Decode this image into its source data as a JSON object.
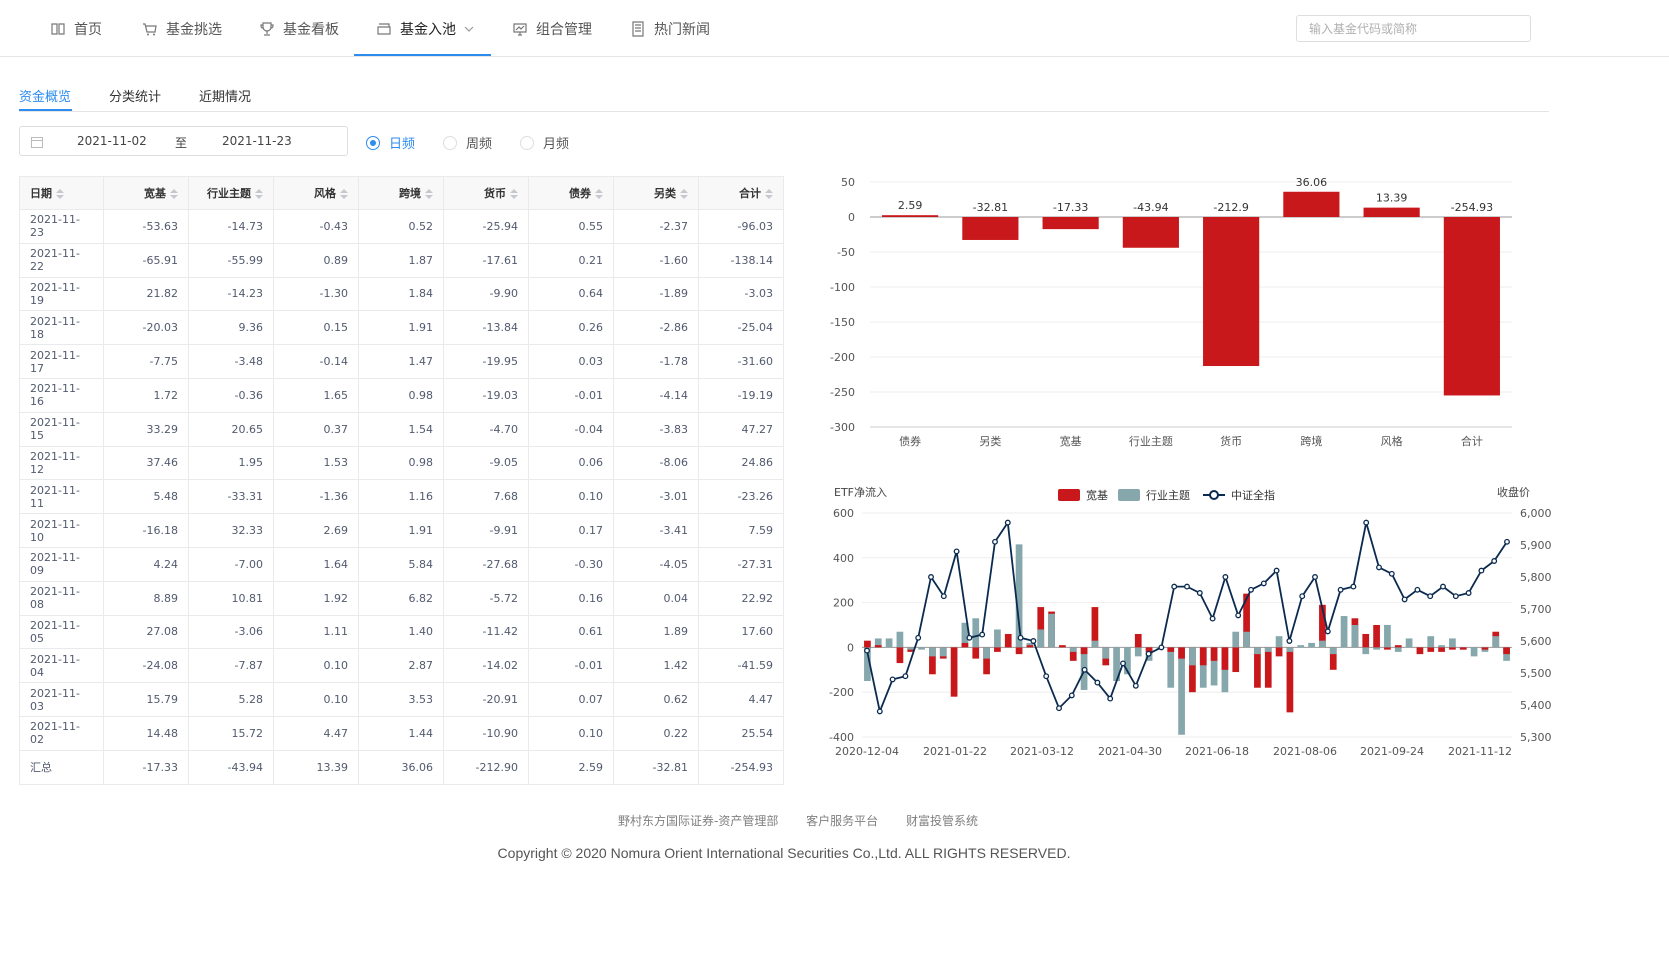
{
  "nav": {
    "items": [
      {
        "label": "首页",
        "icon": "book-icon"
      },
      {
        "label": "基金挑选",
        "icon": "cart-icon"
      },
      {
        "label": "基金看板",
        "icon": "trophy-icon"
      },
      {
        "label": "基金入池",
        "icon": "inbox-icon",
        "active": true
      },
      {
        "label": "组合管理",
        "icon": "chart-screen-icon"
      },
      {
        "label": "热门新闻",
        "icon": "document-icon"
      }
    ],
    "search_placeholder": "输入基金代码或简称"
  },
  "subtabs": [
    "资金概览",
    "分类统计",
    "近期情况"
  ],
  "filters": {
    "start_date": "2021-11-02",
    "separator": "至",
    "end_date": "2021-11-23",
    "frequencies": [
      {
        "label": "日频",
        "checked": true
      },
      {
        "label": "周频",
        "checked": false
      },
      {
        "label": "月频",
        "checked": false
      }
    ]
  },
  "table": {
    "headers": [
      "日期",
      "宽基",
      "行业主题",
      "风格",
      "跨境",
      "货币",
      "债券",
      "另类",
      "合计"
    ],
    "rows": [
      [
        "2021-11-23",
        "-53.63",
        "-14.73",
        "-0.43",
        "0.52",
        "-25.94",
        "0.55",
        "-2.37",
        "-96.03"
      ],
      [
        "2021-11-22",
        "-65.91",
        "-55.99",
        "0.89",
        "1.87",
        "-17.61",
        "0.21",
        "-1.60",
        "-138.14"
      ],
      [
        "2021-11-19",
        "21.82",
        "-14.23",
        "-1.30",
        "1.84",
        "-9.90",
        "0.64",
        "-1.89",
        "-3.03"
      ],
      [
        "2021-11-18",
        "-20.03",
        "9.36",
        "0.15",
        "1.91",
        "-13.84",
        "0.26",
        "-2.86",
        "-25.04"
      ],
      [
        "2021-11-17",
        "-7.75",
        "-3.48",
        "-0.14",
        "1.47",
        "-19.95",
        "0.03",
        "-1.78",
        "-31.60"
      ],
      [
        "2021-11-16",
        "1.72",
        "-0.36",
        "1.65",
        "0.98",
        "-19.03",
        "-0.01",
        "-4.14",
        "-19.19"
      ],
      [
        "2021-11-15",
        "33.29",
        "20.65",
        "0.37",
        "1.54",
        "-4.70",
        "-0.04",
        "-3.83",
        "47.27"
      ],
      [
        "2021-11-12",
        "37.46",
        "1.95",
        "1.53",
        "0.98",
        "-9.05",
        "0.06",
        "-8.06",
        "24.86"
      ],
      [
        "2021-11-11",
        "5.48",
        "-33.31",
        "-1.36",
        "1.16",
        "7.68",
        "0.10",
        "-3.01",
        "-23.26"
      ],
      [
        "2021-11-10",
        "-16.18",
        "32.33",
        "2.69",
        "1.91",
        "-9.91",
        "0.17",
        "-3.41",
        "7.59"
      ],
      [
        "2021-11-09",
        "4.24",
        "-7.00",
        "1.64",
        "5.84",
        "-27.68",
        "-0.30",
        "-4.05",
        "-27.31"
      ],
      [
        "2021-11-08",
        "8.89",
        "10.81",
        "1.92",
        "6.82",
        "-5.72",
        "0.16",
        "0.04",
        "22.92"
      ],
      [
        "2021-11-05",
        "27.08",
        "-3.06",
        "1.11",
        "1.40",
        "-11.42",
        "0.61",
        "1.89",
        "17.60"
      ],
      [
        "2021-11-04",
        "-24.08",
        "-7.87",
        "0.10",
        "2.87",
        "-14.02",
        "-0.01",
        "1.42",
        "-41.59"
      ],
      [
        "2021-11-03",
        "15.79",
        "5.28",
        "0.10",
        "3.53",
        "-20.91",
        "0.07",
        "0.62",
        "4.47"
      ],
      [
        "2021-11-02",
        "14.48",
        "15.72",
        "4.47",
        "1.44",
        "-10.90",
        "0.10",
        "0.22",
        "25.54"
      ],
      [
        "汇总",
        "-17.33",
        "-43.94",
        "13.39",
        "36.06",
        "-212.90",
        "2.59",
        "-32.81",
        "-254.93"
      ]
    ]
  },
  "chart_data": [
    {
      "type": "bar",
      "categories": [
        "债券",
        "另类",
        "宽基",
        "行业主题",
        "货币",
        "跨境",
        "风格",
        "合计"
      ],
      "values": [
        2.59,
        -32.81,
        -17.33,
        -43.94,
        -212.9,
        36.06,
        13.39,
        -254.93
      ],
      "ylim": [
        -300,
        50
      ],
      "yticks": [
        50,
        0,
        -50,
        -100,
        -150,
        -200,
        -250,
        -300
      ],
      "bar_color": "#c9181c"
    },
    {
      "type": "bar+line",
      "ylabel": "ETF净流入",
      "y2label": "收盘价",
      "ylim": [
        -400,
        600
      ],
      "yticks": [
        600,
        400,
        200,
        0,
        -200,
        -400
      ],
      "y2lim": [
        5300,
        6000
      ],
      "y2ticks": [
        "6,000",
        "5,900",
        "5,800",
        "5,700",
        "5,600",
        "5,500",
        "5,400",
        "5,300"
      ],
      "xticks": [
        "2020-12-04",
        "2021-01-22",
        "2021-03-12",
        "2021-04-30",
        "2021-06-18",
        "2021-08-06",
        "2021-09-24",
        "2021-11-12"
      ],
      "legend": [
        {
          "name": "宽基",
          "color": "#c9181c"
        },
        {
          "name": "行业主题",
          "color": "#86a8ad"
        },
        {
          "name": "中证全指",
          "color": "#0b2a4f"
        }
      ],
      "series": [
        {
          "name": "宽基",
          "values": [
            30,
            10,
            0,
            -70,
            -20,
            0,
            -120,
            -50,
            -220,
            20,
            -50,
            -120,
            -20,
            60,
            -30,
            10,
            180,
            160,
            10,
            -60,
            -30,
            180,
            -80,
            0,
            0,
            60,
            -20,
            0,
            -20,
            -50,
            -200,
            -80,
            -60,
            -100,
            -110,
            240,
            -180,
            -180,
            -40,
            -290,
            0,
            0,
            190,
            -100,
            0,
            130,
            60,
            100,
            -10,
            10,
            0,
            -30,
            -20,
            -20,
            -10,
            -10,
            0,
            -10,
            70,
            -30
          ]
        },
        {
          "name": "行业主题",
          "values": [
            -150,
            40,
            40,
            70,
            -10,
            -10,
            -40,
            -40,
            0,
            110,
            130,
            -50,
            80,
            0,
            460,
            20,
            80,
            150,
            0,
            -20,
            -190,
            30,
            -50,
            -150,
            -120,
            -40,
            -60,
            -10,
            -180,
            -390,
            -80,
            -180,
            -170,
            -200,
            70,
            70,
            -30,
            -20,
            50,
            -20,
            10,
            20,
            30,
            -30,
            140,
            100,
            -30,
            -10,
            100,
            -20,
            40,
            0,
            50,
            10,
            40,
            -10,
            -40,
            -20,
            50,
            -60
          ]
        },
        {
          "name": "中证全指",
          "values": [
            5570,
            5380,
            5480,
            5490,
            5610,
            5800,
            5740,
            5880,
            5610,
            5620,
            5910,
            5970,
            5610,
            5600,
            5490,
            5390,
            5430,
            5510,
            5470,
            5420,
            5530,
            5460,
            5560,
            5580,
            5770,
            5770,
            5750,
            5670,
            5800,
            5680,
            5760,
            5780,
            5820,
            5600,
            5740,
            5800,
            5630,
            5760,
            5770,
            5970,
            5830,
            5810,
            5730,
            5760,
            5740,
            5770,
            5740,
            5750,
            5820,
            5850,
            5910
          ]
        }
      ]
    }
  ],
  "footer": {
    "links": [
      "野村东方国际证券-资产管理部",
      "客户服务平台",
      "财富投管系统"
    ],
    "copyright": "Copyright © 2020 Nomura Orient International Securities Co.,Ltd. ALL RIGHTS RESERVED."
  }
}
